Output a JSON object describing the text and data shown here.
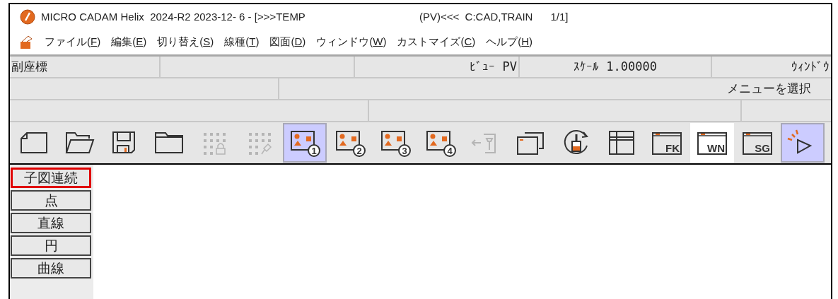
{
  "window": {
    "title_left": "MICRO CADAM Helix  2024-R2 2023-12- 6 - [>>>TEMP",
    "title_right": "(PV)<<<  C:CAD,TRAIN      1/1]"
  },
  "menu": [
    {
      "before": "ファイル(",
      "mnemonic": "F",
      "after": ")"
    },
    {
      "before": "編集(",
      "mnemonic": "E",
      "after": ")"
    },
    {
      "before": "切り替え(",
      "mnemonic": "S",
      "after": ")"
    },
    {
      "before": "線種(",
      "mnemonic": "T",
      "after": ")"
    },
    {
      "before": "図面(",
      "mnemonic": "D",
      "after": ")"
    },
    {
      "before": "ウィンドウ(",
      "mnemonic": "W",
      "after": ")"
    },
    {
      "before": "カストマイズ(",
      "mnemonic": "C",
      "after": ")"
    },
    {
      "before": "ヘルプ(",
      "mnemonic": "H",
      "after": ")"
    }
  ],
  "status_rows": [
    [
      "副座標",
      "",
      "ﾋﾞｭｰ PV",
      "ｽｹｰﾙ 1.00000",
      "ｳｨﾝﾄﾞｳ"
    ],
    [
      "",
      "メニューを選択"
    ],
    [
      "",
      "",
      ""
    ]
  ],
  "toolbar": [
    {
      "kind": "new",
      "selected": false,
      "disabled": false
    },
    {
      "kind": "open",
      "selected": false,
      "disabled": false
    },
    {
      "kind": "save",
      "selected": false,
      "disabled": false
    },
    {
      "kind": "folder",
      "selected": false,
      "disabled": false
    },
    {
      "kind": "grid-lock",
      "selected": false,
      "disabled": true
    },
    {
      "kind": "grid-pin",
      "selected": false,
      "disabled": true
    },
    {
      "kind": "view",
      "badge": "1",
      "selected": true,
      "disabled": false
    },
    {
      "kind": "view",
      "badge": "2",
      "selected": false,
      "disabled": false
    },
    {
      "kind": "view",
      "badge": "3",
      "selected": false,
      "disabled": false
    },
    {
      "kind": "view",
      "badge": "4",
      "selected": false,
      "disabled": false
    },
    {
      "kind": "arrow-pin",
      "selected": false,
      "disabled": true
    },
    {
      "kind": "windows",
      "selected": false,
      "disabled": false
    },
    {
      "kind": "brush-rotate",
      "selected": false,
      "disabled": false
    },
    {
      "kind": "layout",
      "selected": false,
      "disabled": false
    },
    {
      "kind": "tag-window",
      "tag": "FK",
      "selected": false,
      "disabled": false
    },
    {
      "kind": "tag-window",
      "tag": "WN",
      "selected": false,
      "disabled": false,
      "pressed": true
    },
    {
      "kind": "tag-window",
      "tag": "SG",
      "selected": false,
      "disabled": false
    },
    {
      "kind": "sparkle",
      "selected": true,
      "disabled": false
    }
  ],
  "side_menu": [
    {
      "label": "子図連続",
      "highlighted": true
    },
    {
      "label": "点",
      "highlighted": false
    },
    {
      "label": "直線",
      "highlighted": false
    },
    {
      "label": "円",
      "highlighted": false
    },
    {
      "label": "曲線",
      "highlighted": false
    }
  ]
}
